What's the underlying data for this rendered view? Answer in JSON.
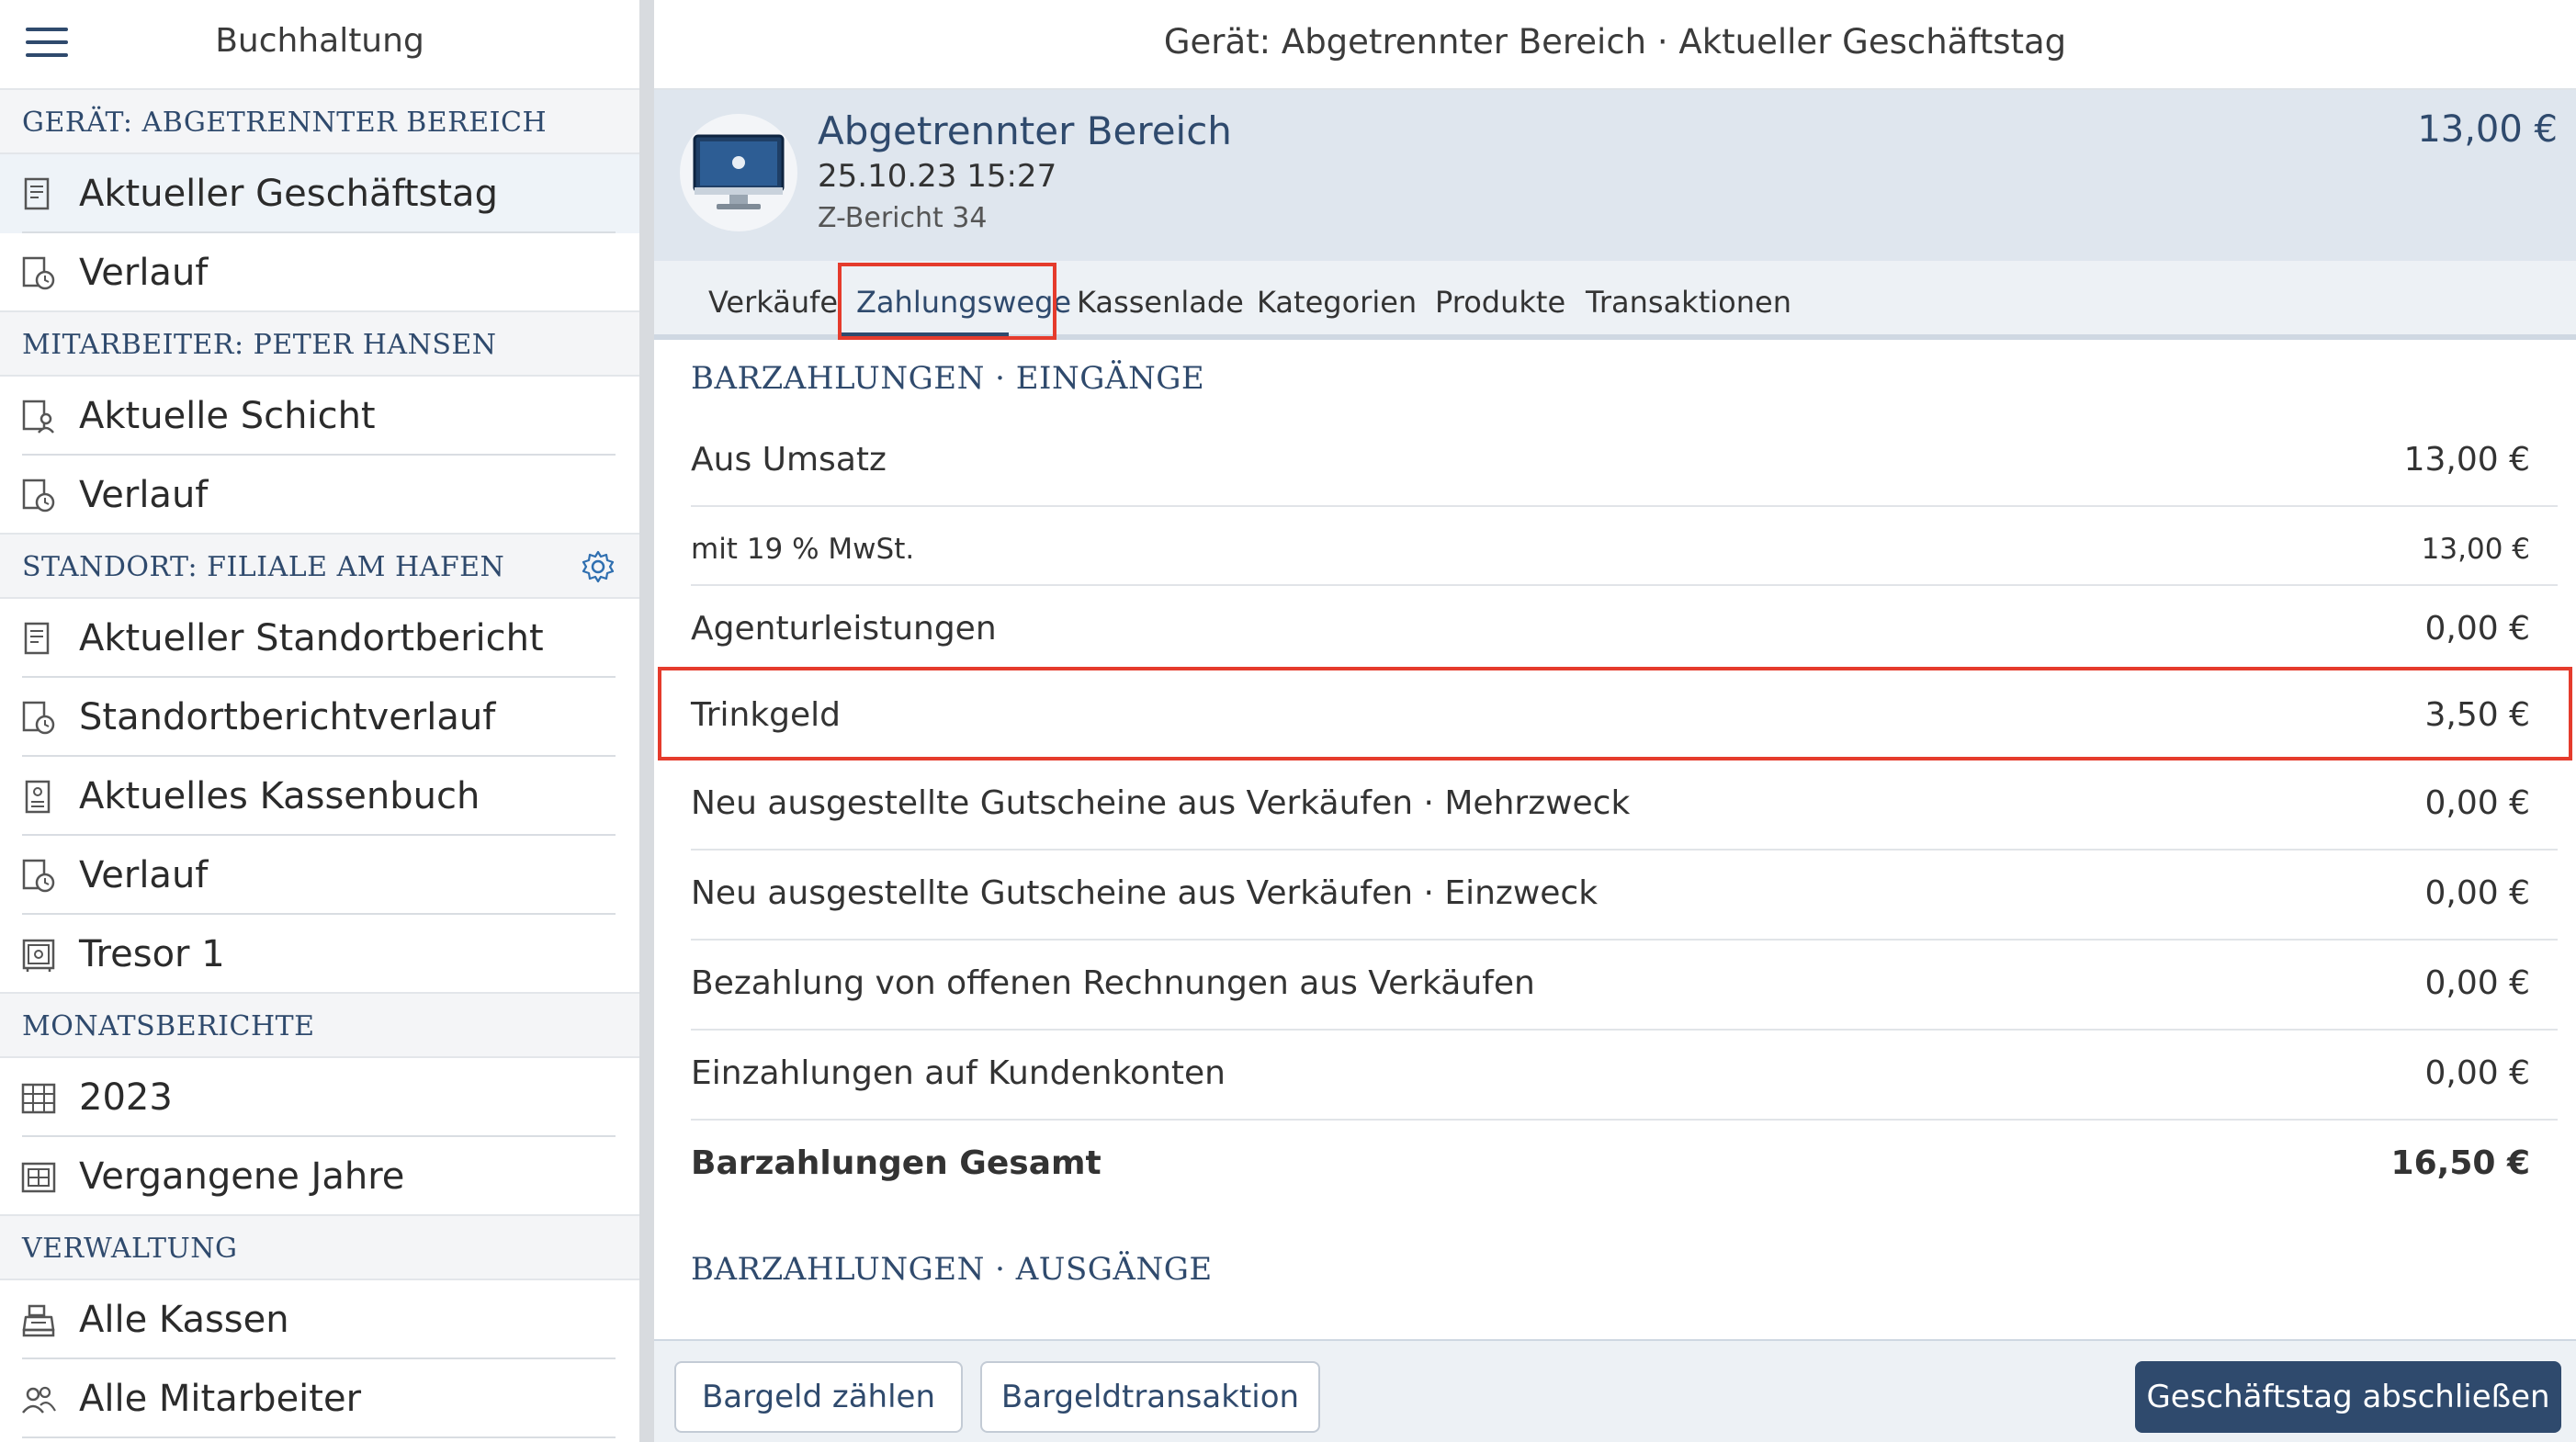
{
  "sidebar": {
    "title": "Buchhaltung",
    "sections": [
      {
        "label": "GERÄT: ABGETRENNTER BEREICH",
        "items": [
          {
            "label": "Aktueller Geschäftstag",
            "icon": "report-icon",
            "active": true
          },
          {
            "label": "Verlauf",
            "icon": "history-icon"
          }
        ]
      },
      {
        "label": "MITARBEITER: PETER HANSEN",
        "items": [
          {
            "label": "Aktuelle Schicht",
            "icon": "shift-icon"
          },
          {
            "label": "Verlauf",
            "icon": "history-icon"
          }
        ]
      },
      {
        "label": "STANDORT: FILIALE AM HAFEN",
        "has_settings": true,
        "settings_icon": "gear-icon",
        "items": [
          {
            "label": "Aktueller Standortbericht",
            "icon": "report-icon"
          },
          {
            "label": "Standortberichtverlauf",
            "icon": "history-icon"
          },
          {
            "label": "Aktuelles Kassenbuch",
            "icon": "cashbook-icon"
          },
          {
            "label": "Verlauf",
            "icon": "history-icon"
          },
          {
            "label": "Tresor 1",
            "icon": "safe-icon"
          }
        ]
      },
      {
        "label": "MONATSBERICHTE",
        "items": [
          {
            "label": "2023",
            "icon": "calendar-icon"
          },
          {
            "label": "Vergangene Jahre",
            "icon": "calendar-history-icon"
          }
        ]
      },
      {
        "label": "VERWALTUNG",
        "items": [
          {
            "label": "Alle Kassen",
            "icon": "register-icon"
          },
          {
            "label": "Alle Mitarbeiter",
            "icon": "users-icon"
          }
        ]
      }
    ]
  },
  "header": {
    "title": "Gerät: Abgetrennter Bereich · Aktueller Geschäftstag"
  },
  "device": {
    "icon": "computer-icon",
    "name": "Abgetrennter Bereich",
    "datetime": "25.10.23 15:27",
    "report": "Z-Bericht 34",
    "amount": "13,00 €"
  },
  "tabs": [
    {
      "label": "Verkäufe"
    },
    {
      "label": "Zahlungswege",
      "selected": true
    },
    {
      "label": "Kassenlade"
    },
    {
      "label": "Kategorien"
    },
    {
      "label": "Produkte"
    },
    {
      "label": "Transaktionen"
    }
  ],
  "cash_in": {
    "heading": "BARZAHLUNGEN · EINGÄNGE",
    "rows": [
      {
        "label": "Aus Umsatz",
        "value": "13,00 €"
      },
      {
        "label": "mit 19 % MwSt.",
        "value": "13,00 €"
      },
      {
        "label": "Agenturleistungen",
        "value": "0,00 €"
      },
      {
        "label": "Trinkgeld",
        "value": "3,50 €"
      },
      {
        "label": "Neu ausgestellte Gutscheine aus Verkäufen · Mehrzweck",
        "value": "0,00 €"
      },
      {
        "label": "Neu ausgestellte Gutscheine aus Verkäufen · Einzweck",
        "value": "0,00 €"
      },
      {
        "label": "Bezahlung von offenen Rechnungen aus Verkäufen",
        "value": "0,00 €"
      },
      {
        "label": "Einzahlungen auf Kundenkonten",
        "value": "0,00 €"
      },
      {
        "label": "Barzahlungen Gesamt",
        "value": "16,50 €"
      }
    ]
  },
  "cash_out": {
    "heading": "BARZAHLUNGEN · AUSGÄNGE"
  },
  "actions": {
    "count_cash": "Bargeld zählen",
    "cash_transaction": "Bargeldtransaktion",
    "close_day": "Geschäftstag abschließen"
  },
  "colors": {
    "accent": "#2f4a6d",
    "highlight": "#e53b2c",
    "panel": "#dfe6ee"
  }
}
